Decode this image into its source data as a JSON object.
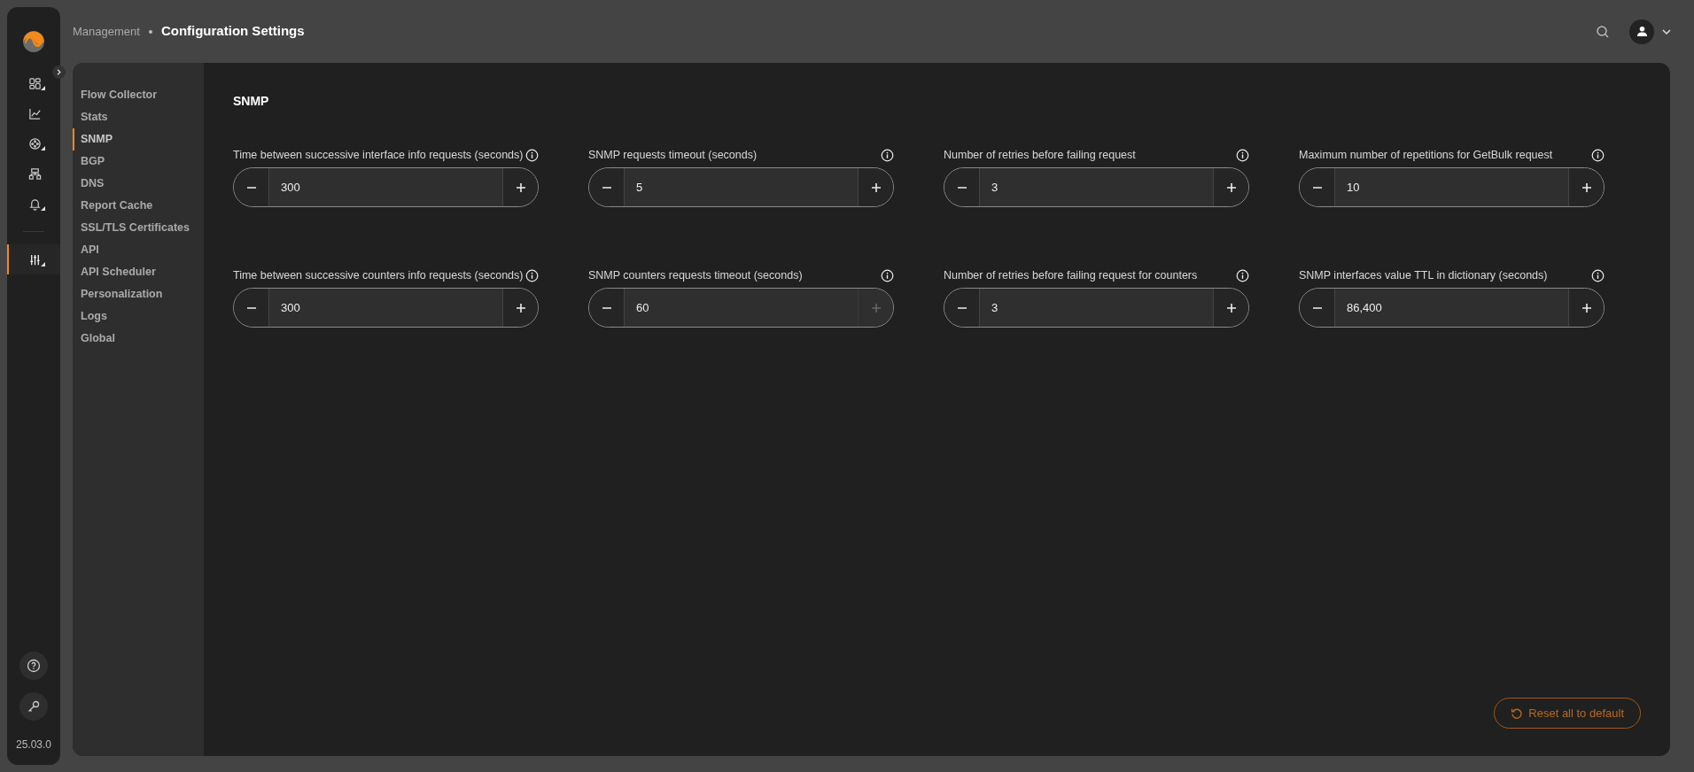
{
  "rail": {
    "version": "25.03.0",
    "groups": [
      {
        "items": [
          {
            "kind": "dashboard",
            "submenu": true,
            "selected": false
          },
          {
            "kind": "chart",
            "submenu": false,
            "selected": false
          },
          {
            "kind": "network",
            "submenu": true,
            "selected": false
          },
          {
            "kind": "topology",
            "submenu": false,
            "selected": false
          },
          {
            "kind": "bell",
            "submenu": true,
            "selected": false
          }
        ]
      },
      {
        "items": [
          {
            "kind": "sliders",
            "submenu": true,
            "selected": true
          }
        ]
      }
    ]
  },
  "breadcrumb": {
    "parent": "Management",
    "current": "Configuration Settings"
  },
  "nav": [
    {
      "label": "Flow Collector",
      "selected": false
    },
    {
      "label": "Stats",
      "selected": false
    },
    {
      "label": "SNMP",
      "selected": true
    },
    {
      "label": "BGP",
      "selected": false
    },
    {
      "label": "DNS",
      "selected": false
    },
    {
      "label": "Report Cache",
      "selected": false
    },
    {
      "label": "SSL/TLS Certificates",
      "selected": false
    },
    {
      "label": "API",
      "selected": false
    },
    {
      "label": "API Scheduler",
      "selected": false
    },
    {
      "label": "Personalization",
      "selected": false
    },
    {
      "label": "Logs",
      "selected": false
    },
    {
      "label": "Global",
      "selected": false
    }
  ],
  "section_title": "SNMP",
  "fields": [
    {
      "label": "Time between successive interface info requests (seconds)",
      "value": "300",
      "increment_disabled": false
    },
    {
      "label": "SNMP requests timeout (seconds)",
      "value": "5",
      "increment_disabled": false
    },
    {
      "label": "Number of retries before failing request",
      "value": "3",
      "increment_disabled": false
    },
    {
      "label": "Maximum number of repetitions for GetBulk request",
      "value": "10",
      "increment_disabled": false
    },
    {
      "label": "Time between successive counters info requests (seconds)",
      "value": "300",
      "increment_disabled": false
    },
    {
      "label": "SNMP counters requests timeout (seconds)",
      "value": "60",
      "increment_disabled": true
    },
    {
      "label": "Number of retries before failing request for counters",
      "value": "3",
      "increment_disabled": false
    },
    {
      "label": "SNMP interfaces value TTL in dictionary (seconds)",
      "value": "86,400",
      "increment_disabled": false
    }
  ],
  "reset_button": "Reset all to default"
}
